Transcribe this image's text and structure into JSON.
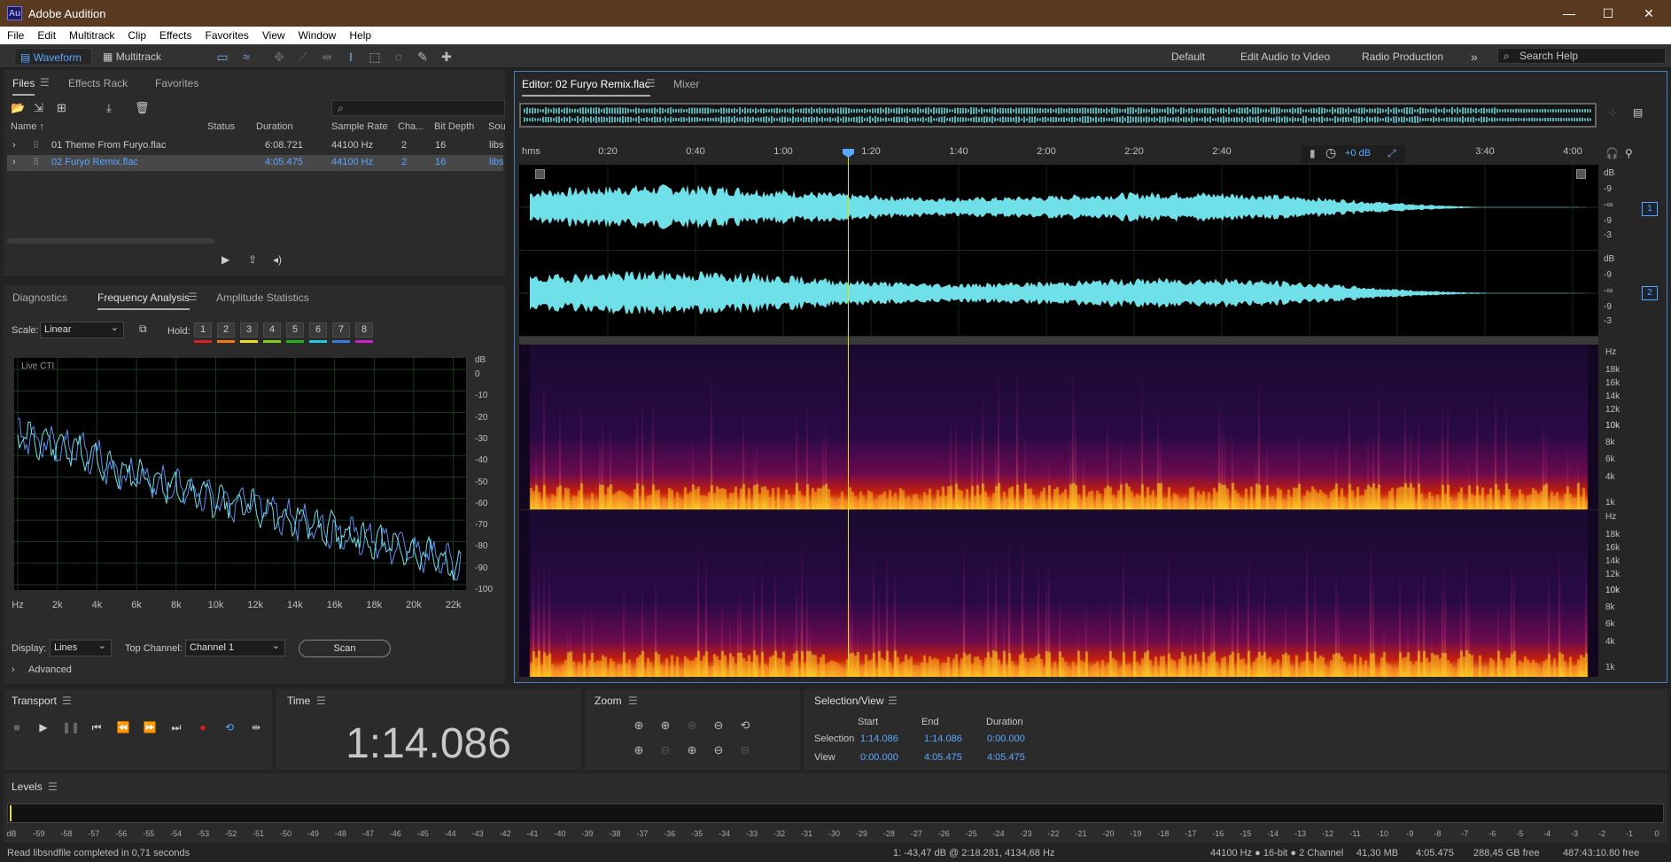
{
  "window": {
    "title": "Adobe Audition",
    "logo": "Au"
  },
  "menu": [
    "File",
    "Edit",
    "Multitrack",
    "Clip",
    "Effects",
    "Favorites",
    "View",
    "Window",
    "Help"
  ],
  "toolbar": {
    "waveform_label": "Waveform",
    "multitrack_label": "Multitrack",
    "workspaces": [
      "Default",
      "Edit Audio to Video",
      "Radio Production"
    ],
    "more": "»",
    "search_placeholder": "Search Help"
  },
  "files_panel": {
    "tabs": [
      "Files",
      "Effects Rack",
      "Favorites"
    ],
    "columns": [
      "Name ↑",
      "Status",
      "Duration",
      "Sample Rate",
      "Cha...",
      "Bit Depth",
      "Sou"
    ],
    "rows": [
      {
        "name": "01 Theme From Furyo.flac",
        "status": "",
        "duration": "6:08.721",
        "rate": "44100 Hz",
        "ch": "2",
        "bits": "16",
        "src": "libs"
      },
      {
        "name": "02 Furyo Remix.flac",
        "status": "",
        "duration": "4:05.475",
        "rate": "44100 Hz",
        "ch": "2",
        "bits": "16",
        "src": "libs"
      }
    ]
  },
  "analysis_panel": {
    "tabs": [
      "Diagnostics",
      "Frequency Analysis",
      "Amplitude Statistics"
    ],
    "scale_label": "Scale:",
    "scale_value": "Linear",
    "hold_label": "Hold:",
    "holds": [
      "1",
      "2",
      "3",
      "4",
      "5",
      "6",
      "7",
      "8"
    ],
    "hold_colors": [
      "#e02020",
      "#f07a10",
      "#f0e020",
      "#80d020",
      "#20b020",
      "#20c8d8",
      "#3a7ae0",
      "#d020d0"
    ],
    "live_label": "Live CTI",
    "db_unit": "dB",
    "db_ticks": [
      "0",
      "-10",
      "-20",
      "-30",
      "-40",
      "-50",
      "-60",
      "-70",
      "-80",
      "-90",
      "-100"
    ],
    "freq_ticks": [
      "Hz",
      "2k",
      "4k",
      "6k",
      "8k",
      "10k",
      "12k",
      "14k",
      "16k",
      "18k",
      "20k",
      "22k"
    ],
    "display_label": "Display:",
    "display_value": "Lines",
    "top_channel_label": "Top Channel:",
    "top_channel_value": "Channel 1",
    "scan_label": "Scan",
    "advanced_label": "Advanced"
  },
  "editor": {
    "tab_label": "Editor: 02 Furyo Remix.flac",
    "mixer_label": "Mixer",
    "timeline_unit": "hms",
    "timeline_ticks": [
      "0:20",
      "0:40",
      "1:00",
      "1:20",
      "1:40",
      "2:00",
      "2:20",
      "2:40",
      "3:40",
      "4:00"
    ],
    "volume_label": "+0 dB",
    "playhead_fraction": 0.302,
    "channel_badges": [
      "1",
      "2"
    ],
    "wave_db_labels": [
      "dB",
      "-9",
      "-∞",
      "-9",
      "-3"
    ],
    "hz_labels": [
      "Hz",
      "18k",
      "16k",
      "14k",
      "12k",
      "10k",
      "8k",
      "6k",
      "4k",
      "1k"
    ]
  },
  "transport": {
    "title": "Transport"
  },
  "time": {
    "title": "Time",
    "value": "1:14.086"
  },
  "zoom": {
    "title": "Zoom"
  },
  "selection": {
    "title": "Selection/View",
    "headers": [
      "Start",
      "End",
      "Duration"
    ],
    "rows": [
      {
        "label": "Selection",
        "start": "1:14.086",
        "end": "1:14.086",
        "duration": "0:00.000"
      },
      {
        "label": "View",
        "start": "0:00.000",
        "end": "4:05.475",
        "duration": "4:05.475"
      }
    ]
  },
  "levels": {
    "title": "Levels",
    "ticks": [
      "dB",
      "-59",
      "-58",
      "-57",
      "-56",
      "-55",
      "-54",
      "-53",
      "-52",
      "-51",
      "-50",
      "-49",
      "-48",
      "-47",
      "-46",
      "-45",
      "-44",
      "-43",
      "-42",
      "-41",
      "-40",
      "-39",
      "-38",
      "-37",
      "-36",
      "-35",
      "-34",
      "-33",
      "-32",
      "-31",
      "-30",
      "-29",
      "-28",
      "-27",
      "-26",
      "-25",
      "-24",
      "-23",
      "-22",
      "-21",
      "-20",
      "-19",
      "-18",
      "-17",
      "-16",
      "-15",
      "-14",
      "-13",
      "-12",
      "-11",
      "-10",
      "-9",
      "-8",
      "-7",
      "-6",
      "-5",
      "-4",
      "-3",
      "-2",
      "-1",
      "0"
    ]
  },
  "status": {
    "message": "Read libsndfile completed in 0,71 seconds",
    "cursor": "1: -43,47 dB @ 2:18.281, 4134,68 Hz",
    "format": "44100 Hz ● 16-bit ● 2 Channel",
    "size": "41,30 MB",
    "duration": "4:05.475",
    "free": "288,45 GB free",
    "time_free": "487:43:10.80 free"
  },
  "colors": {
    "waveform": "#6fe0e8",
    "accent": "#5aa7ff",
    "playhead": "#e8e000"
  }
}
